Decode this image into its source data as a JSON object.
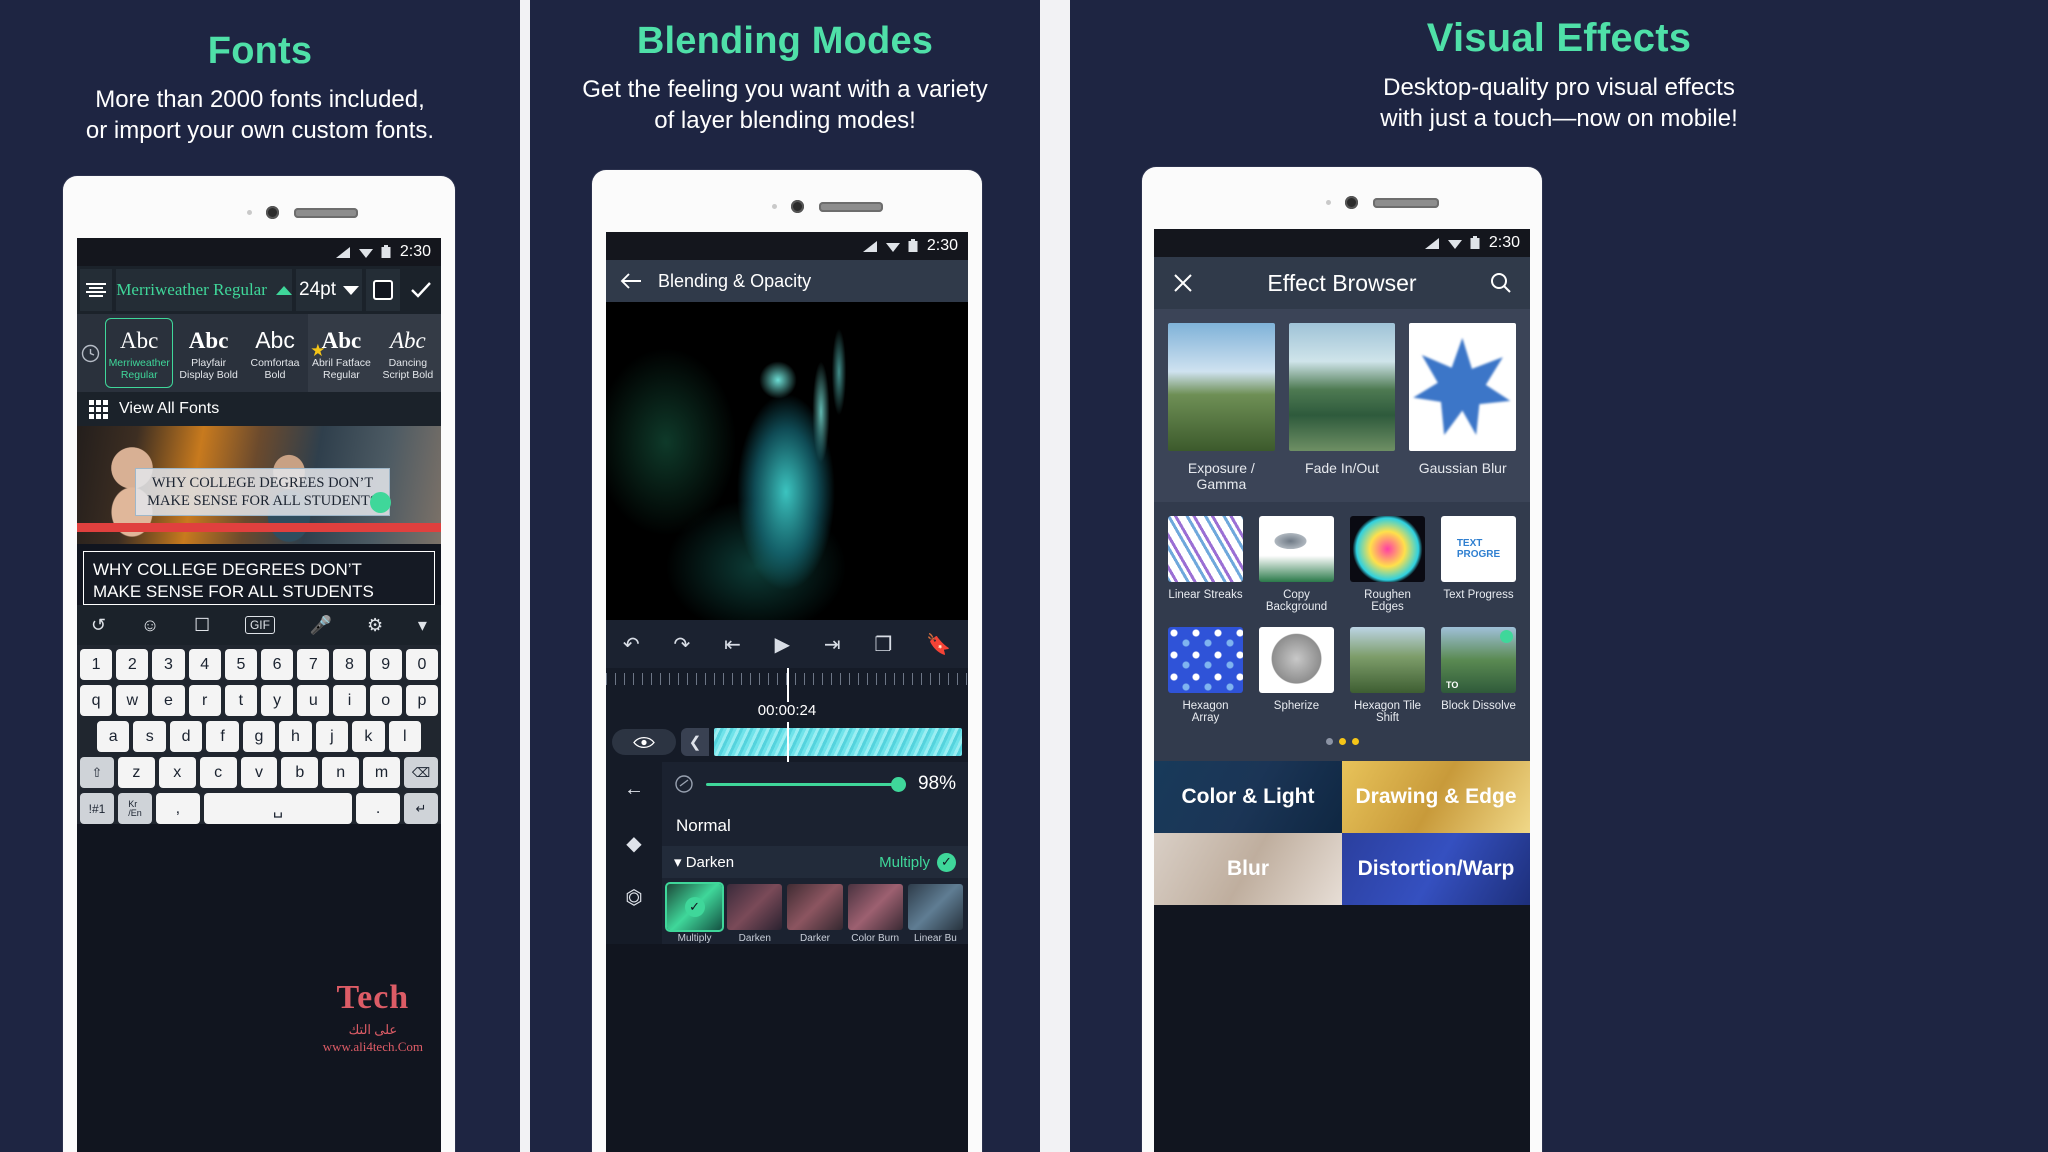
{
  "panels": [
    {
      "title": "Fonts",
      "subtitle_line1": "More than 2000 fonts included,",
      "subtitle_line2": "or import your own custom fonts.",
      "status_time": "2:30",
      "toolbar": {
        "align_icon": "text-align-icon",
        "font_name": "Merriweather Regular",
        "font_name_caret": "caret-up-icon",
        "font_size": "24pt",
        "font_size_caret": "caret-down-icon",
        "color_swatch_icon": "color-square-icon",
        "confirm_icon": "check-icon"
      },
      "font_chips": [
        {
          "sample": "Abc",
          "name_line1": "Merriweather",
          "name_line2": "Regular",
          "selected": true,
          "favorite": false
        },
        {
          "sample": "Abc",
          "name_line1": "Playfair",
          "name_line2": "Display Bold",
          "selected": false,
          "favorite": false
        },
        {
          "sample": "Abc",
          "name_line1": "Comfortaa",
          "name_line2": "Bold",
          "selected": false,
          "favorite": false
        },
        {
          "sample": "Abc",
          "name_line1": "Abril Fatface",
          "name_line2": "Regular",
          "selected": false,
          "favorite": true
        },
        {
          "sample": "Abc",
          "name_line1": "Dancing",
          "name_line2": "Script Bold",
          "selected": false,
          "favorite": false
        }
      ],
      "recents_icon": "clock-icon",
      "view_all_fonts": "View All Fonts",
      "view_all_icon": "grid-icon",
      "canvas_headline_line1": "WHY COLLEGE DEGREES DON’T",
      "canvas_headline_line2": "MAKE SENSE FOR ALL STUDENTS",
      "editor_text_line1": "WHY COLLEGE DEGREES DON’T",
      "editor_text_line2": "MAKE SENSE FOR ALL STUDENTS",
      "keyboard_toolbar_icons": [
        "translate-icon",
        "emoji-icon",
        "sticker-icon",
        "gif-icon",
        "microphone-icon",
        "gear-icon",
        "chevron-down-icon"
      ],
      "keyboard_rows": [
        [
          "1",
          "2",
          "3",
          "4",
          "5",
          "6",
          "7",
          "8",
          "9",
          "0"
        ],
        [
          "q",
          "w",
          "e",
          "r",
          "t",
          "y",
          "u",
          "i",
          "o",
          "p"
        ],
        [
          "a",
          "s",
          "d",
          "f",
          "g",
          "h",
          "j",
          "k",
          "l"
        ],
        [
          "⇧",
          "z",
          "x",
          "c",
          "v",
          "b",
          "n",
          "m",
          "⌫"
        ],
        [
          "!#1",
          "Kr\n/En",
          ",",
          "␣",
          ".",
          "↵"
        ]
      ],
      "watermark_big": "Tech",
      "watermark_ar": "على التك",
      "watermark_url": "www.ali4tech.Com"
    },
    {
      "title": "Blending Modes",
      "subtitle_line1": "Get the feeling you want with a variety",
      "subtitle_line2": "of layer blending modes!",
      "status_time": "2:30",
      "appbar_back_icon": "arrow-left-icon",
      "appbar_title": "Blending & Opacity",
      "transport_icons": [
        "undo-icon",
        "redo-icon",
        "skip-to-start-icon",
        "play-icon",
        "skip-to-end-icon",
        "duplicate-icon",
        "bookmark-icon"
      ],
      "timecode": "00:00:24",
      "track_eye_icon": "eye-icon",
      "track_collapse_icon": "chevron-left-icon",
      "opacity_back_icon": "arrow-left-icon",
      "opacity_link_icon": "link-icon",
      "opacity_value": "98%",
      "blend_mode_current": "Normal",
      "group_label": "Darken",
      "group_expand_icon": "caret-down-icon",
      "group_selected_value": "Multiply",
      "group_selected_icon": "check-circle-icon",
      "mode_thumbs": [
        {
          "label": "Multiply",
          "selected": true
        },
        {
          "label": "Darken",
          "selected": false
        },
        {
          "label": "Darker",
          "selected": false
        },
        {
          "label": "Color Burn",
          "selected": false
        },
        {
          "label": "Linear Bu",
          "selected": false
        }
      ],
      "rail_icons": [
        "arrow-left-icon",
        "keyframe-diamond-icon",
        "transform-icon"
      ]
    },
    {
      "title": "Visual Effects",
      "subtitle_line1": "Desktop-quality pro visual effects",
      "subtitle_line2": "with just a touch—now on mobile!",
      "status_time": "2:30",
      "close_icon": "close-icon",
      "browser_title": "Effect Browser",
      "search_icon": "search-icon",
      "featured": [
        {
          "label": "Exposure / Gamma"
        },
        {
          "label": "Fade In/Out"
        },
        {
          "label": "Gaussian Blur"
        }
      ],
      "effects_row1": [
        {
          "label": "Linear Streaks"
        },
        {
          "label": "Copy Background"
        },
        {
          "label": "Roughen Edges"
        },
        {
          "label": "Text Progress"
        }
      ],
      "effects_row2": [
        {
          "label": "Hexagon Array"
        },
        {
          "label": "Spherize"
        },
        {
          "label": "Hexagon Tile Shift"
        },
        {
          "label": "Block Dissolve"
        }
      ],
      "page_dots": 3,
      "categories": [
        {
          "label": "Color & Light"
        },
        {
          "label": "Drawing & Edge"
        },
        {
          "label": "Blur"
        },
        {
          "label": "Distortion/Warp"
        }
      ]
    }
  ],
  "colors": {
    "background": "#1e2542",
    "accent": "#4fe0a8",
    "panel_title": "#4fe0a8",
    "text": "#ffffff"
  }
}
